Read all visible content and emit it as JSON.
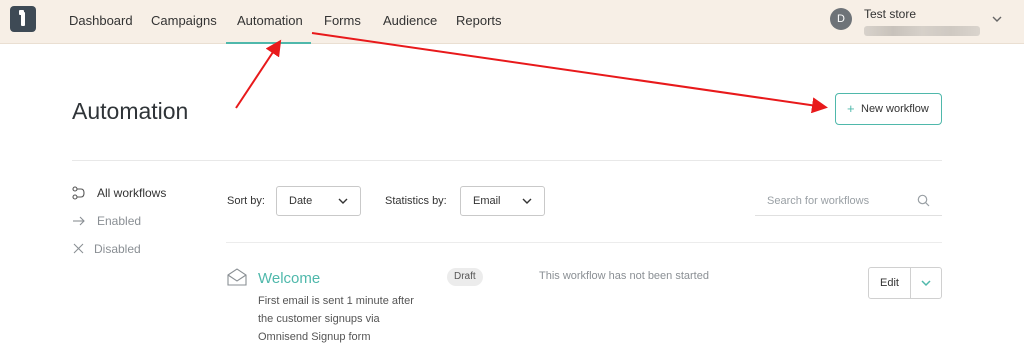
{
  "nav": {
    "items": [
      "Dashboard",
      "Campaigns",
      "Automation",
      "Forms",
      "Audience",
      "Reports"
    ],
    "active": "Automation",
    "accent": "#4fb8ab",
    "background": "#f7efe6"
  },
  "account": {
    "avatar_initial": "D",
    "store_name": "Test store"
  },
  "page": {
    "title": "Automation",
    "new_workflow_button": "New workflow"
  },
  "sidebar": {
    "items": [
      {
        "label": "All workflows",
        "icon": "workflow-icon",
        "active": true
      },
      {
        "label": "Enabled",
        "icon": "arrow-right-icon",
        "active": false
      },
      {
        "label": "Disabled",
        "icon": "x-icon",
        "active": false
      }
    ]
  },
  "controls": {
    "sort_label": "Sort by:",
    "sort_value": "Date",
    "stats_label": "Statistics by:",
    "stats_value": "Email",
    "search_placeholder": "Search for workflows"
  },
  "workflows": [
    {
      "name": "Welcome",
      "description": "First email is sent 1 minute after the customer signups via Omnisend Signup form",
      "badge": "Draft",
      "status": "This workflow has not been started",
      "edit_label": "Edit"
    }
  ],
  "annotation_color": "#e8191b"
}
